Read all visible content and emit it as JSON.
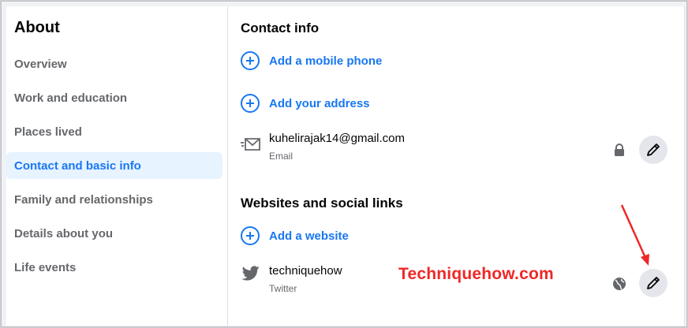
{
  "sidebar": {
    "title": "About",
    "items": [
      {
        "label": "Overview",
        "active": false
      },
      {
        "label": "Work and education",
        "active": false
      },
      {
        "label": "Places lived",
        "active": false
      },
      {
        "label": "Contact and basic info",
        "active": true
      },
      {
        "label": "Family and relationships",
        "active": false
      },
      {
        "label": "Details about you",
        "active": false
      },
      {
        "label": "Life events",
        "active": false
      }
    ]
  },
  "contact": {
    "title": "Contact info",
    "add_phone": "Add a mobile phone",
    "add_address": "Add your address",
    "email": {
      "value": "kuhelirajak14@gmail.com",
      "type": "Email",
      "privacy_icon": "lock-icon"
    }
  },
  "websites": {
    "title": "Websites and social links",
    "add_website": "Add a website",
    "twitter": {
      "value": "techniquehow",
      "type": "Twitter",
      "privacy_icon": "globe-icon"
    }
  },
  "watermark": "Techniquehow.com",
  "colors": {
    "accent": "#1877f2",
    "active_bg": "#e7f3ff",
    "annotation": "#f02727"
  }
}
